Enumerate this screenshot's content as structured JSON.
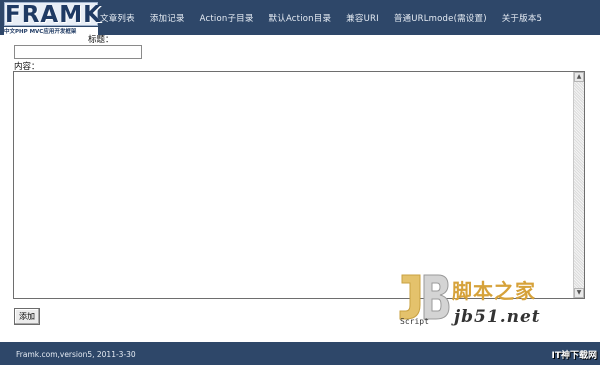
{
  "header": {
    "logo_text": "FRAMK",
    "logo_tagline": "中文PHP MVC应用开发框架",
    "nav": [
      "文章列表",
      "添加记录",
      "Action子目录",
      "默认Action目录",
      "兼容URI",
      "普通URLmode(需设置)",
      "关于版本5"
    ]
  },
  "form": {
    "title_label": "标题：",
    "title_value": "",
    "content_label": "内容：",
    "content_value": "",
    "submit_label": "添加"
  },
  "footer": {
    "text": "Framk.com,version5, 2011-3-30"
  },
  "watermark": {
    "script_label": "Script",
    "cn_text": "脚本之家",
    "domain": "jb51.net",
    "corner_text": "IT神下载网"
  },
  "colors": {
    "bar_bg": "#2e4769",
    "nav_text": "#e6ecf4",
    "watermark_orange": "#d6a23a"
  }
}
